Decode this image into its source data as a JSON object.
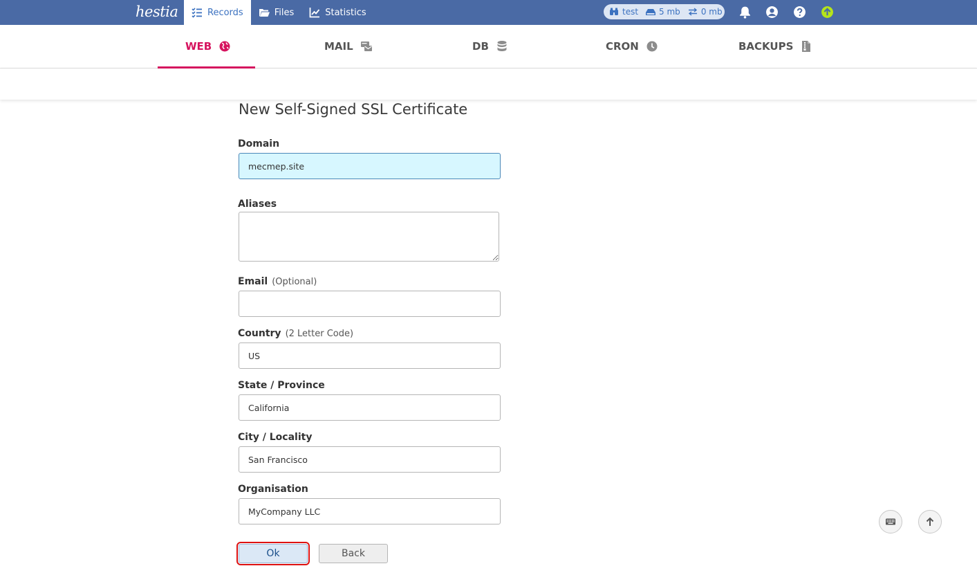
{
  "header": {
    "logo_text": "hestia",
    "nav": [
      {
        "label": "Records",
        "icon": "list-check-icon",
        "active": true
      },
      {
        "label": "Files",
        "icon": "folder-icon",
        "active": false
      },
      {
        "label": "Statistics",
        "icon": "chart-line-icon",
        "active": false
      }
    ],
    "usage": {
      "user": "test",
      "disk": "5 mb",
      "bandwidth": "0 mb"
    },
    "icons": [
      "bell-icon",
      "user-circle-icon",
      "question-circle-icon",
      "update-arrow-icon"
    ],
    "colors": {
      "bar": "#4a6aa5",
      "update": "#b5e41a"
    }
  },
  "tabs": [
    {
      "label": "WEB",
      "icon": "globe-icon",
      "active": true
    },
    {
      "label": "MAIL",
      "icon": "mail-stack-icon",
      "active": false
    },
    {
      "label": "DB",
      "icon": "database-icon",
      "active": false
    },
    {
      "label": "CRON",
      "icon": "clock-icon",
      "active": false
    },
    {
      "label": "BACKUPS",
      "icon": "file-archive-icon",
      "active": false
    }
  ],
  "form": {
    "title": "New Self-Signed SSL Certificate",
    "domain": {
      "label": "Domain",
      "value": "mecmep.site"
    },
    "aliases": {
      "label": "Aliases",
      "value": ""
    },
    "email": {
      "label": "Email",
      "hint": "(Optional)",
      "value": ""
    },
    "country": {
      "label": "Country",
      "hint": "(2 Letter Code)",
      "value": "US"
    },
    "state": {
      "label": "State / Province",
      "value": "California"
    },
    "city": {
      "label": "City / Locality",
      "value": "San Francisco"
    },
    "org": {
      "label": "Organisation",
      "value": "MyCompany LLC"
    },
    "ok_label": "Ok",
    "back_label": "Back"
  },
  "accent_color": "#d6145f"
}
